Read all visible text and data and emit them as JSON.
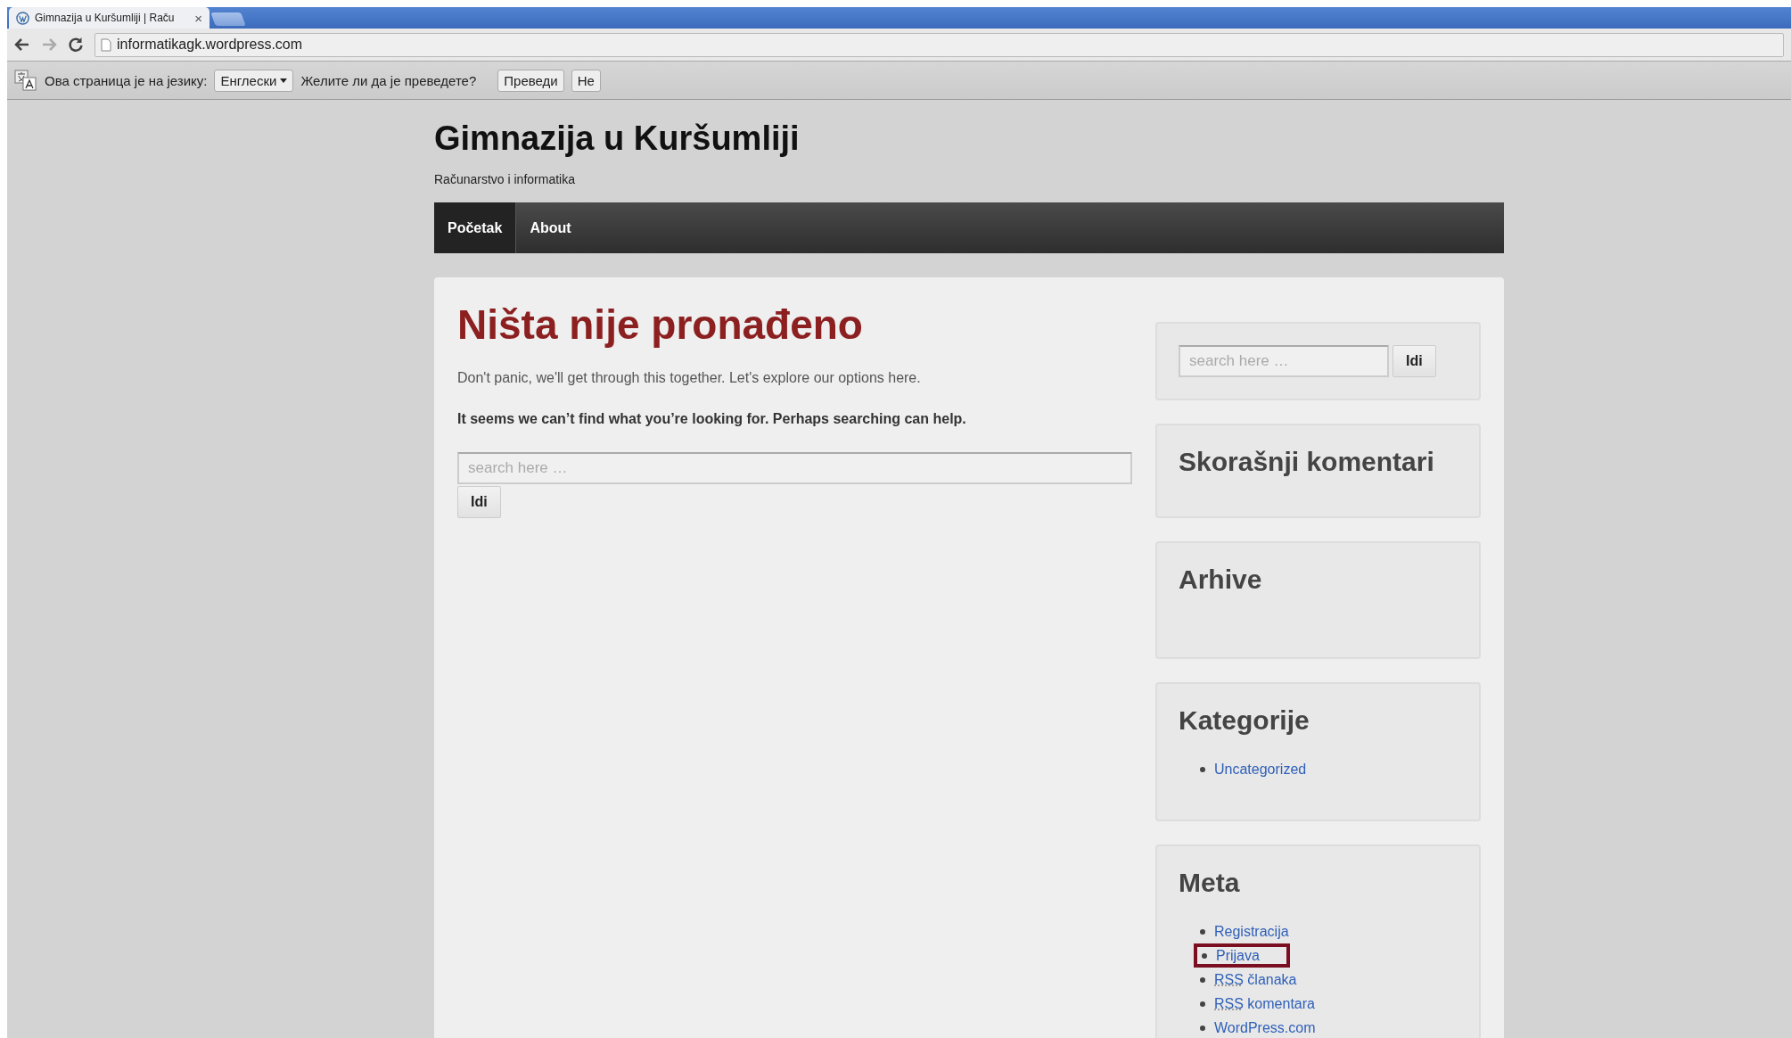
{
  "browser": {
    "tab": {
      "title": "Gimnazija u Kuršumliji | Raču",
      "close": "×"
    },
    "address": "informatikagk.wordpress.com"
  },
  "translate_bar": {
    "message": "Ова страница је на језику:",
    "language": "Енглески",
    "question": "Желите ли да је преведете?",
    "buttons": [
      "Преведи",
      "Не"
    ]
  },
  "site": {
    "title": "Gimnazija u Kuršumliji",
    "tagline": "Računarstvo i informatika",
    "nav": [
      {
        "label": "Početak",
        "selected": true
      },
      {
        "label": "About",
        "selected": false
      }
    ]
  },
  "main": {
    "heading": "Ništa nije pronađeno",
    "intro": "Don't panic, we'll get through this together. Let's explore our options here.",
    "prompt": "It seems we can’t find what you’re looking for. Perhaps searching can help.",
    "search": {
      "placeholder": "search here …",
      "button": "Idi"
    }
  },
  "sidebar": {
    "search": {
      "placeholder": "search here …",
      "button": "Idi"
    },
    "widgets": [
      {
        "title": "Skorašnji komentari"
      },
      {
        "title": "Arhive"
      },
      {
        "title": "Kategorije",
        "items": [
          {
            "label": "Uncategorized",
            "highlighted": false
          }
        ]
      },
      {
        "title": "Meta",
        "items": [
          {
            "label": "Registracija",
            "highlighted": false
          },
          {
            "label": "Prijava",
            "highlighted": true
          },
          {
            "abbr": "RSS",
            "label": "članaka",
            "highlighted": false
          },
          {
            "abbr": "RSS",
            "label": "komentara",
            "highlighted": false
          },
          {
            "label": "WordPress.com",
            "highlighted": false
          }
        ]
      }
    ]
  }
}
